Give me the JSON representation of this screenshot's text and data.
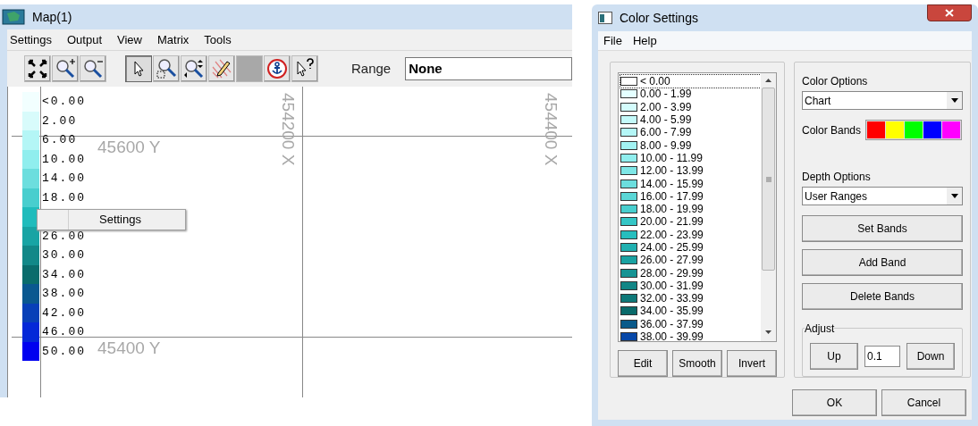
{
  "map_window": {
    "title": "Map(1)",
    "menu": [
      "Settings",
      "Output",
      "View",
      "Matrix",
      "Tools"
    ],
    "tools": [
      {
        "kind": "fit",
        "selected": false
      },
      {
        "kind": "zoom_in",
        "selected": false
      },
      {
        "kind": "zoom_out",
        "selected": false
      },
      {
        "kind": "pointer",
        "selected": true
      },
      {
        "kind": "zoom_box",
        "selected": false
      },
      {
        "kind": "zoom_pan",
        "selected": false
      },
      {
        "kind": "pencil",
        "selected": false
      },
      {
        "kind": "blank",
        "selected": false
      },
      {
        "kind": "anchor",
        "selected": false
      },
      {
        "kind": "help",
        "selected": false
      }
    ],
    "range": {
      "label": "Range",
      "value": "None"
    },
    "legend": [
      {
        "label": "<0.00",
        "color": "#f2ffff"
      },
      {
        "label": "2.00",
        "color": "#d8fbfb"
      },
      {
        "label": "6.00",
        "color": "#b4f6f6"
      },
      {
        "label": "10.00",
        "color": "#90eeee"
      },
      {
        "label": "14.00",
        "color": "#6cdede"
      },
      {
        "label": "18.00",
        "color": "#48cece"
      },
      {
        "color": "#20bcbc"
      },
      {
        "label": "26.00",
        "color": "#18a4a4"
      },
      {
        "label": "30.00",
        "color": "#128888"
      },
      {
        "label": "34.00",
        "color": "#0a6c6c"
      },
      {
        "label": "38.00",
        "color": "#0a5890"
      },
      {
        "label": "42.00",
        "color": "#0840b8"
      },
      {
        "label": "46.00",
        "color": "#0428d8"
      },
      {
        "label": "50.00",
        "color": "#0000f0"
      }
    ],
    "grid_labels": {
      "y_top": "45600 Y",
      "y_bottom": "45400 Y",
      "x_left": "454200 X",
      "x_right": "454400 X"
    },
    "context_menu": [
      "Settings"
    ]
  },
  "dialog": {
    "title": "Color Settings",
    "menu": [
      "File",
      "Help"
    ],
    "bands": [
      {
        "label": "< 0.00",
        "color": "#ffffff",
        "selected": true
      },
      {
        "label": "0.00 - 1.99",
        "color": "#e4ffff",
        "selected": false
      },
      {
        "label": "2.00 - 3.99",
        "color": "#d4fcfc",
        "selected": false
      },
      {
        "label": "4.00 - 5.99",
        "color": "#c4fafa",
        "selected": false
      },
      {
        "label": "6.00 - 7.99",
        "color": "#b4f6f6",
        "selected": false
      },
      {
        "label": "8.00 - 9.99",
        "color": "#a2f2f2",
        "selected": false
      },
      {
        "label": "10.00 - 11.99",
        "color": "#90eeee",
        "selected": false
      },
      {
        "label": "12.00 - 13.99",
        "color": "#7ee6e6",
        "selected": false
      },
      {
        "label": "14.00 - 15.99",
        "color": "#6cdede",
        "selected": false
      },
      {
        "label": "16.00 - 17.99",
        "color": "#5ad6d6",
        "selected": false
      },
      {
        "label": "18.00 - 19.99",
        "color": "#48cece",
        "selected": false
      },
      {
        "label": "20.00 - 21.99",
        "color": "#34c6c6",
        "selected": false
      },
      {
        "label": "22.00 - 23.99",
        "color": "#26bebe",
        "selected": false
      },
      {
        "label": "24.00 - 25.99",
        "color": "#20b0b0",
        "selected": false
      },
      {
        "label": "26.00 - 27.99",
        "color": "#1aa2a2",
        "selected": false
      },
      {
        "label": "28.00 - 29.99",
        "color": "#169494",
        "selected": false
      },
      {
        "label": "30.00 - 31.99",
        "color": "#128686",
        "selected": false
      },
      {
        "label": "32.00 - 33.99",
        "color": "#0e7878",
        "selected": false
      },
      {
        "label": "34.00 - 35.99",
        "color": "#0a6a6a",
        "selected": false
      },
      {
        "label": "36.00 - 37.99",
        "color": "#0a5a8a",
        "selected": false
      },
      {
        "label": "38.00 - 39.99",
        "color": "#0848a8",
        "selected": false
      }
    ],
    "list_buttons": [
      "Edit",
      "Smooth",
      "Invert"
    ],
    "color_options": {
      "label": "Color Options",
      "value": "Chart"
    },
    "color_bands": {
      "label": "Color Bands",
      "colors": [
        {
          "color": "#ff0000"
        },
        {
          "color": "#ffff00"
        },
        {
          "color": "#00ff00"
        },
        {
          "color": "#0000ff"
        },
        {
          "color": "#ff00ff"
        }
      ]
    },
    "depth_options": {
      "label": "Depth Options",
      "value": "User Ranges"
    },
    "actions": [
      "Set Bands",
      "Add Band",
      "Delete Bands"
    ],
    "adjust": {
      "label": "Adjust",
      "up": "Up",
      "step": "0.1",
      "down": "Down"
    },
    "footer": [
      "OK",
      "Cancel"
    ]
  }
}
